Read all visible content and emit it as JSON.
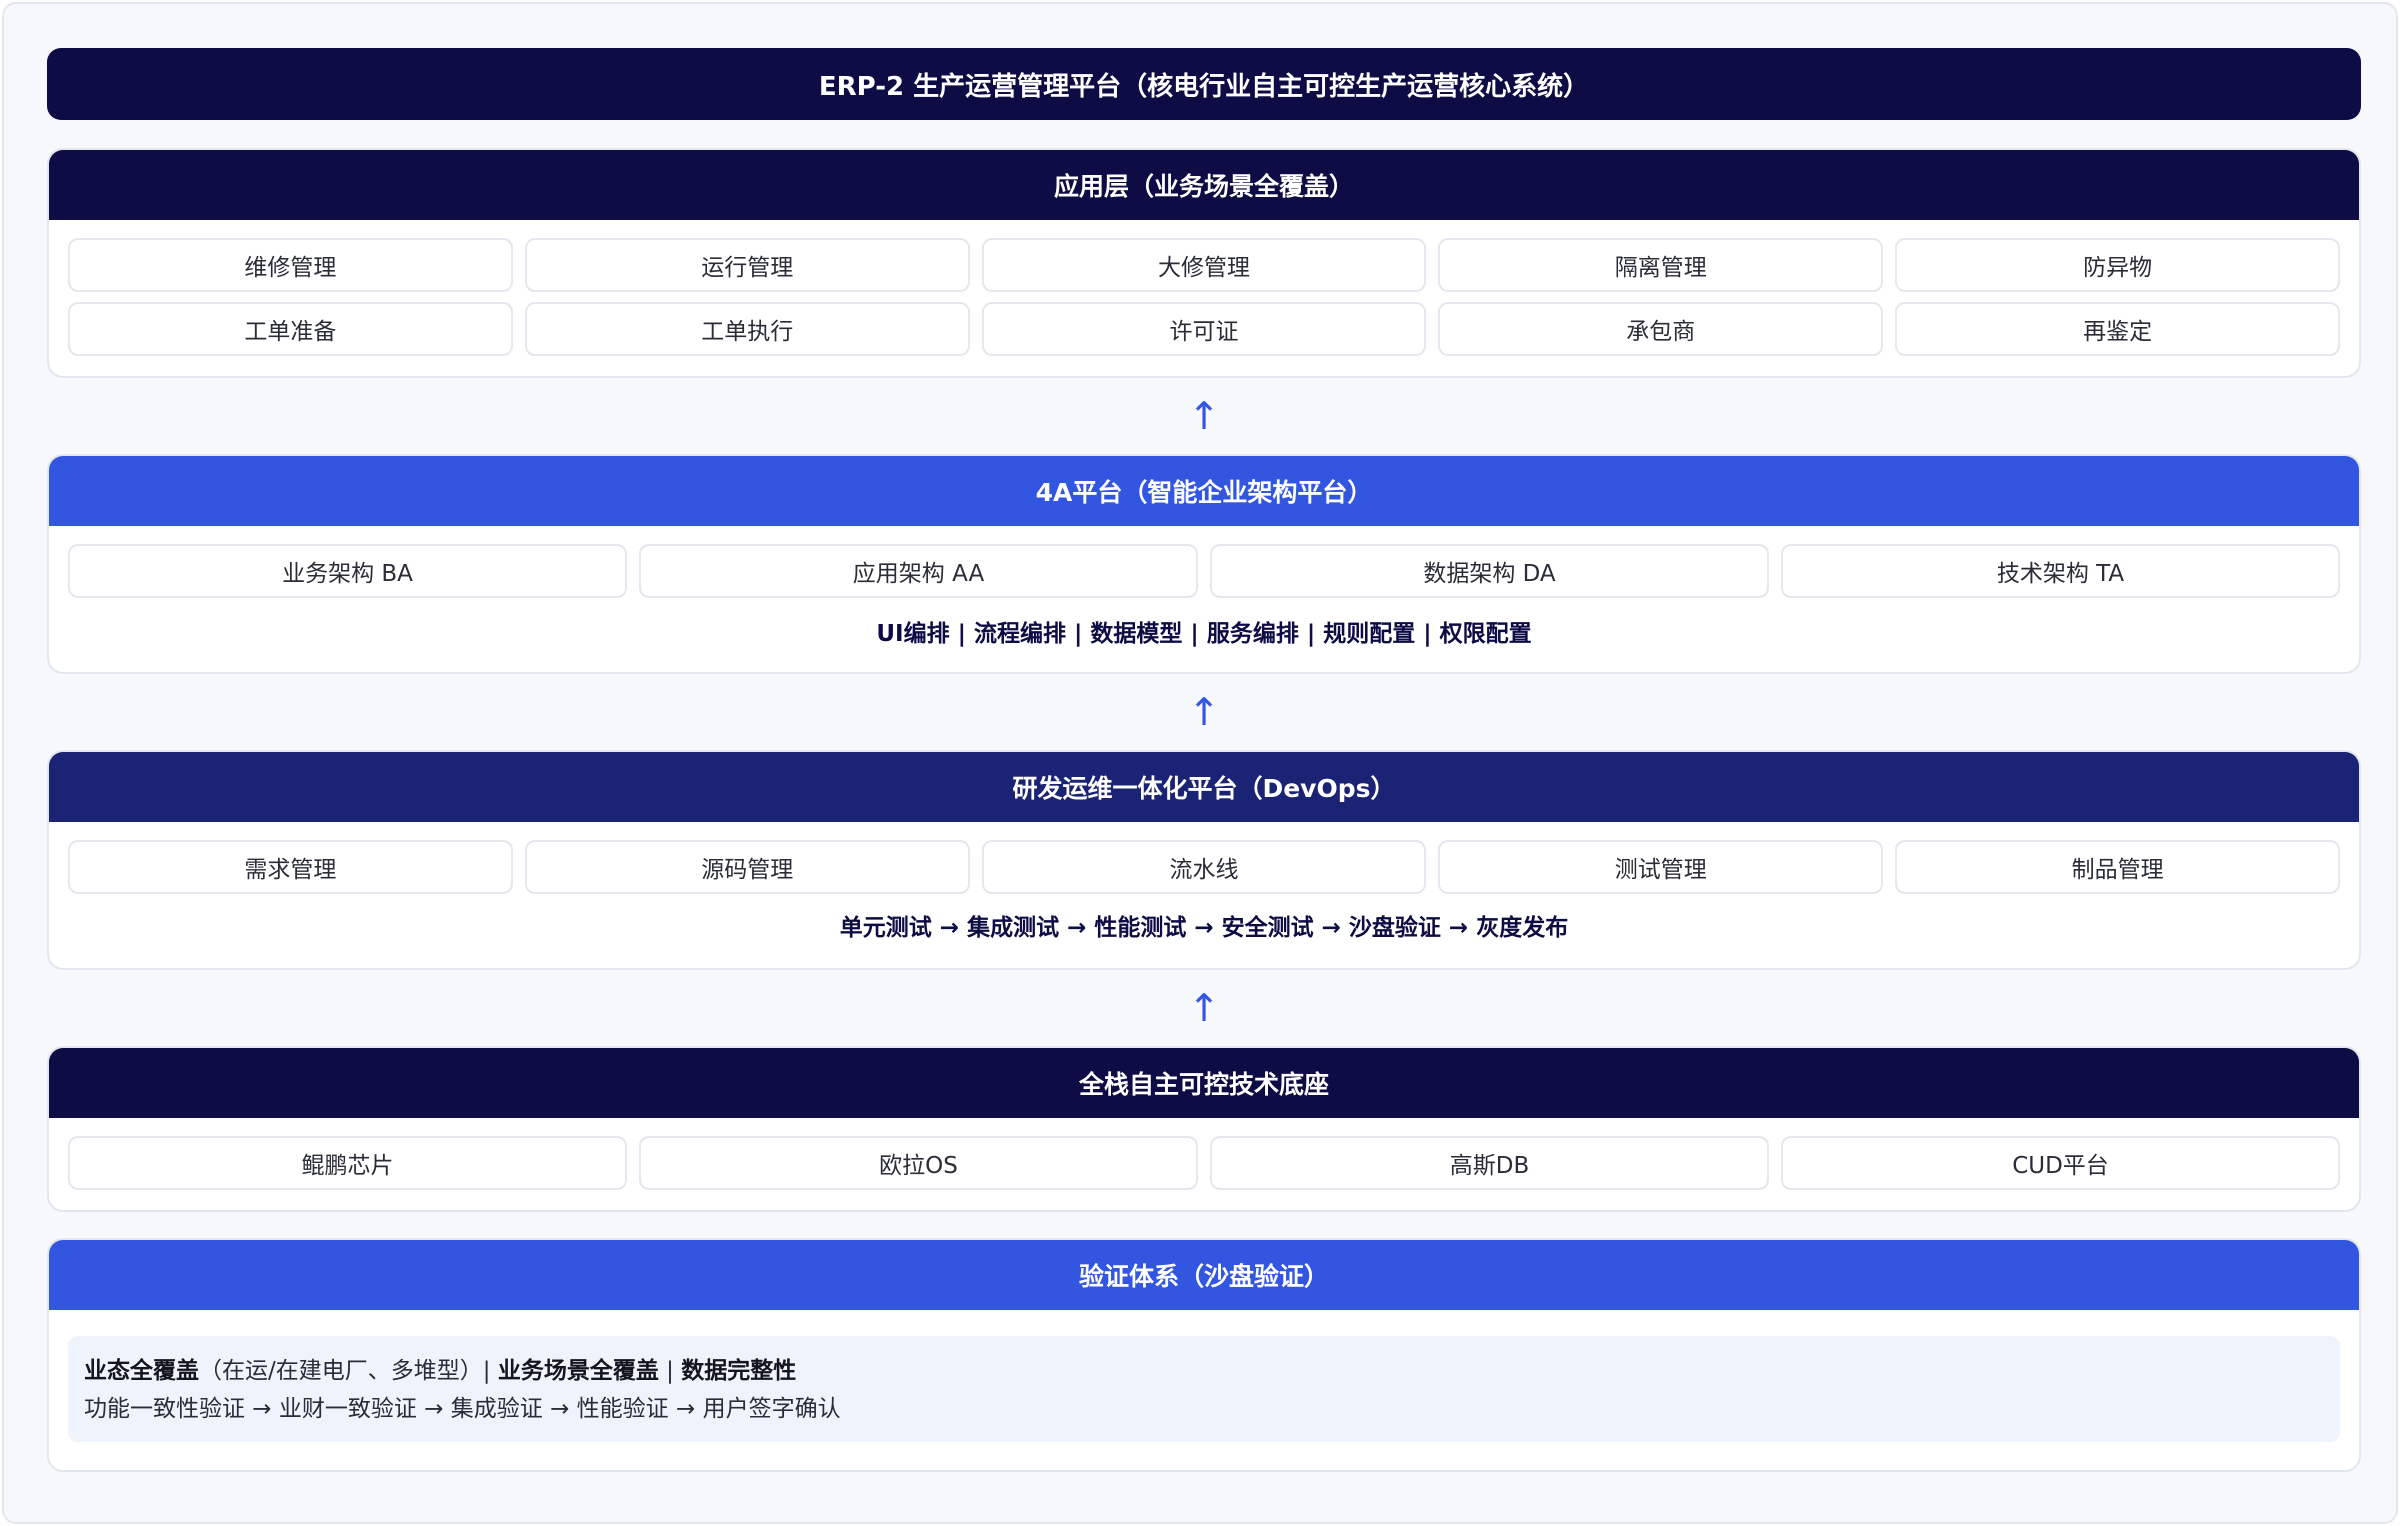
{
  "title": "ERP-2 生产运营管理平台（核电行业自主可控生产运营核心系统）",
  "arrow_symbol": "↑",
  "app_layer": {
    "title": "应用层（业务场景全覆盖）",
    "row1": [
      "维修管理",
      "运行管理",
      "大修管理",
      "隔离管理",
      "防异物"
    ],
    "row2": [
      "工单准备",
      "工单执行",
      "许可证",
      "承包商",
      "再鉴定"
    ]
  },
  "platform_4a": {
    "title": "4A平台（智能企业架构平台）",
    "items": [
      "业务架构 BA",
      "应用架构 AA",
      "数据架构 DA",
      "技术架构 TA"
    ],
    "capabilities": "UI编排 | 流程编排 | 数据模型 | 服务编排 | 规则配置 | 权限配置"
  },
  "devops": {
    "title": "研发运维一体化平台（DevOps）",
    "items": [
      "需求管理",
      "源码管理",
      "流水线",
      "测试管理",
      "制品管理"
    ],
    "pipeline": "单元测试 → 集成测试 → 性能测试 → 安全测试 → 沙盘验证 → 灰度发布"
  },
  "tech_base": {
    "title": "全栈自主可控技术底座",
    "items": [
      "鲲鹏芯片",
      "欧拉OS",
      "高斯DB",
      "CUD平台"
    ]
  },
  "verification": {
    "title": "验证体系（沙盘验证）",
    "line1_bold_a": "业态全覆盖",
    "line1_normal": "（在运/在建电厂、多堆型）| ",
    "line1_bold_b": "业务场景全覆盖",
    "line1_sep": " | ",
    "line1_bold_c": "数据完整性",
    "line2": "功能一致性验证 → 业财一致验证 → 集成验证 → 性能验证 → 用户签字确认"
  },
  "colors": {
    "navy": "#0d0c45",
    "blue": "#3256e0",
    "indigo": "#1b2375"
  }
}
